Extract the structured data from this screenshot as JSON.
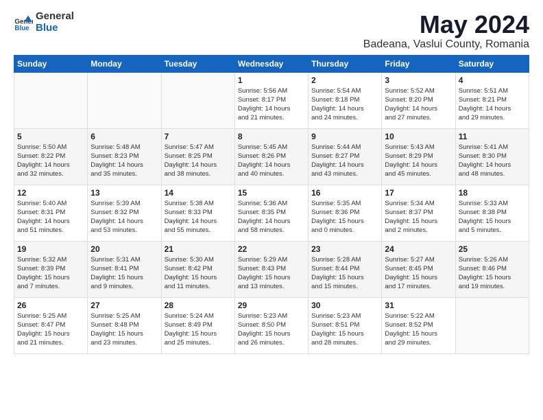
{
  "logo": {
    "text_general": "General",
    "text_blue": "Blue"
  },
  "header": {
    "month_year": "May 2024",
    "location": "Badeana, Vaslui County, Romania"
  },
  "days_of_week": [
    "Sunday",
    "Monday",
    "Tuesday",
    "Wednesday",
    "Thursday",
    "Friday",
    "Saturday"
  ],
  "weeks": [
    [
      {
        "day": "",
        "info": ""
      },
      {
        "day": "",
        "info": ""
      },
      {
        "day": "",
        "info": ""
      },
      {
        "day": "1",
        "info": "Sunrise: 5:56 AM\nSunset: 8:17 PM\nDaylight: 14 hours\nand 21 minutes."
      },
      {
        "day": "2",
        "info": "Sunrise: 5:54 AM\nSunset: 8:18 PM\nDaylight: 14 hours\nand 24 minutes."
      },
      {
        "day": "3",
        "info": "Sunrise: 5:52 AM\nSunset: 8:20 PM\nDaylight: 14 hours\nand 27 minutes."
      },
      {
        "day": "4",
        "info": "Sunrise: 5:51 AM\nSunset: 8:21 PM\nDaylight: 14 hours\nand 29 minutes."
      }
    ],
    [
      {
        "day": "5",
        "info": "Sunrise: 5:50 AM\nSunset: 8:22 PM\nDaylight: 14 hours\nand 32 minutes."
      },
      {
        "day": "6",
        "info": "Sunrise: 5:48 AM\nSunset: 8:23 PM\nDaylight: 14 hours\nand 35 minutes."
      },
      {
        "day": "7",
        "info": "Sunrise: 5:47 AM\nSunset: 8:25 PM\nDaylight: 14 hours\nand 38 minutes."
      },
      {
        "day": "8",
        "info": "Sunrise: 5:45 AM\nSunset: 8:26 PM\nDaylight: 14 hours\nand 40 minutes."
      },
      {
        "day": "9",
        "info": "Sunrise: 5:44 AM\nSunset: 8:27 PM\nDaylight: 14 hours\nand 43 minutes."
      },
      {
        "day": "10",
        "info": "Sunrise: 5:43 AM\nSunset: 8:29 PM\nDaylight: 14 hours\nand 45 minutes."
      },
      {
        "day": "11",
        "info": "Sunrise: 5:41 AM\nSunset: 8:30 PM\nDaylight: 14 hours\nand 48 minutes."
      }
    ],
    [
      {
        "day": "12",
        "info": "Sunrise: 5:40 AM\nSunset: 8:31 PM\nDaylight: 14 hours\nand 51 minutes."
      },
      {
        "day": "13",
        "info": "Sunrise: 5:39 AM\nSunset: 8:32 PM\nDaylight: 14 hours\nand 53 minutes."
      },
      {
        "day": "14",
        "info": "Sunrise: 5:38 AM\nSunset: 8:33 PM\nDaylight: 14 hours\nand 55 minutes."
      },
      {
        "day": "15",
        "info": "Sunrise: 5:36 AM\nSunset: 8:35 PM\nDaylight: 14 hours\nand 58 minutes."
      },
      {
        "day": "16",
        "info": "Sunrise: 5:35 AM\nSunset: 8:36 PM\nDaylight: 15 hours\nand 0 minutes."
      },
      {
        "day": "17",
        "info": "Sunrise: 5:34 AM\nSunset: 8:37 PM\nDaylight: 15 hours\nand 2 minutes."
      },
      {
        "day": "18",
        "info": "Sunrise: 5:33 AM\nSunset: 8:38 PM\nDaylight: 15 hours\nand 5 minutes."
      }
    ],
    [
      {
        "day": "19",
        "info": "Sunrise: 5:32 AM\nSunset: 8:39 PM\nDaylight: 15 hours\nand 7 minutes."
      },
      {
        "day": "20",
        "info": "Sunrise: 5:31 AM\nSunset: 8:41 PM\nDaylight: 15 hours\nand 9 minutes."
      },
      {
        "day": "21",
        "info": "Sunrise: 5:30 AM\nSunset: 8:42 PM\nDaylight: 15 hours\nand 11 minutes."
      },
      {
        "day": "22",
        "info": "Sunrise: 5:29 AM\nSunset: 8:43 PM\nDaylight: 15 hours\nand 13 minutes."
      },
      {
        "day": "23",
        "info": "Sunrise: 5:28 AM\nSunset: 8:44 PM\nDaylight: 15 hours\nand 15 minutes."
      },
      {
        "day": "24",
        "info": "Sunrise: 5:27 AM\nSunset: 8:45 PM\nDaylight: 15 hours\nand 17 minutes."
      },
      {
        "day": "25",
        "info": "Sunrise: 5:26 AM\nSunset: 8:46 PM\nDaylight: 15 hours\nand 19 minutes."
      }
    ],
    [
      {
        "day": "26",
        "info": "Sunrise: 5:25 AM\nSunset: 8:47 PM\nDaylight: 15 hours\nand 21 minutes."
      },
      {
        "day": "27",
        "info": "Sunrise: 5:25 AM\nSunset: 8:48 PM\nDaylight: 15 hours\nand 23 minutes."
      },
      {
        "day": "28",
        "info": "Sunrise: 5:24 AM\nSunset: 8:49 PM\nDaylight: 15 hours\nand 25 minutes."
      },
      {
        "day": "29",
        "info": "Sunrise: 5:23 AM\nSunset: 8:50 PM\nDaylight: 15 hours\nand 26 minutes."
      },
      {
        "day": "30",
        "info": "Sunrise: 5:23 AM\nSunset: 8:51 PM\nDaylight: 15 hours\nand 28 minutes."
      },
      {
        "day": "31",
        "info": "Sunrise: 5:22 AM\nSunset: 8:52 PM\nDaylight: 15 hours\nand 29 minutes."
      },
      {
        "day": "",
        "info": ""
      }
    ]
  ]
}
